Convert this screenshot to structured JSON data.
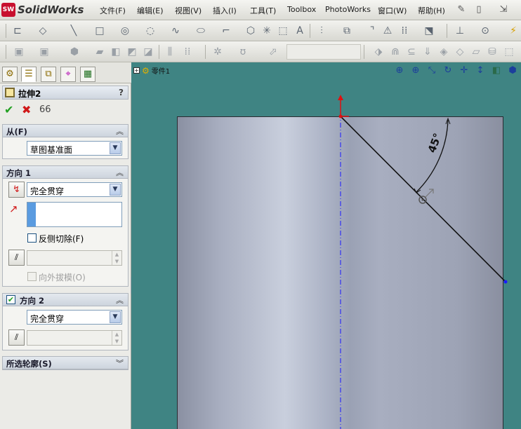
{
  "app": {
    "logo_text": "SolidWorks",
    "logo_badge": "SW",
    "menu": [
      "文件(F)",
      "编辑(E)",
      "视图(V)",
      "插入(I)",
      "工具(T)",
      "Toolbox",
      "PhotoWorks",
      "窗口(W)",
      "帮助(H)"
    ]
  },
  "panel": {
    "feature_title": "拉伸2",
    "help": "?",
    "ok_icon": "✔",
    "cancel_icon": "✖",
    "preview_icon": "66",
    "from": {
      "title": "从(F)",
      "value": "草图基准面"
    },
    "direction1": {
      "title": "方向 1",
      "end_condition": "完全贯穿",
      "flip_side_label": "反侧切除(F)",
      "flip_side_checked": false,
      "draft_outward_label": "向外拔模(O)",
      "draft_outward_enabled": false
    },
    "direction2": {
      "title": "方向 2",
      "checked": true,
      "end_condition": "完全贯穿"
    },
    "selected_contours": {
      "title": "所选轮廓(S)"
    }
  },
  "viewport": {
    "tree_label": "零件1",
    "angle_label": "45°",
    "background": "#3f8483",
    "sketch_line_color": "#111111",
    "centerline_color": "#1a1aff",
    "origin_color": "#e01010"
  }
}
